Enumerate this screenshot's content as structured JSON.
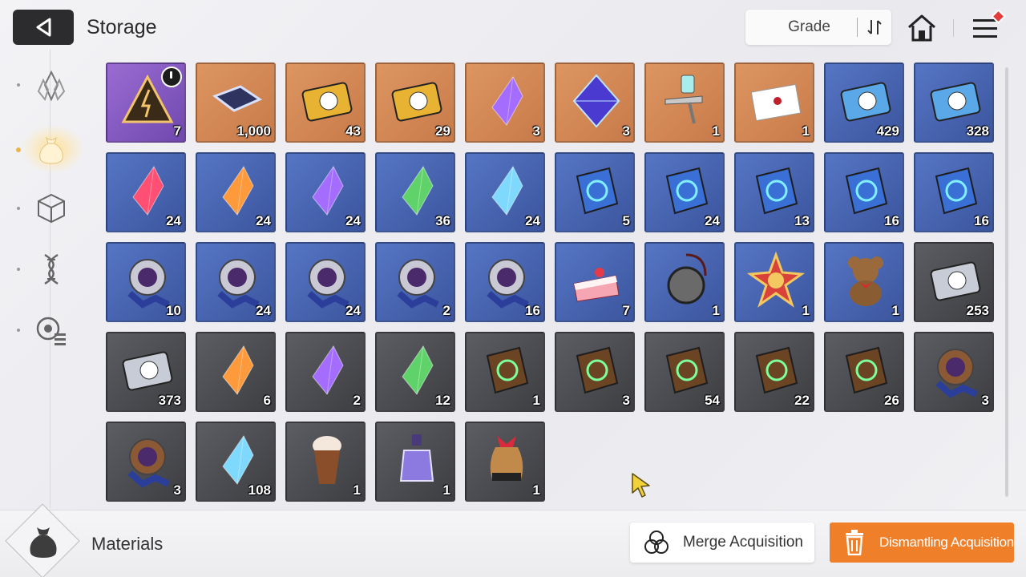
{
  "header": {
    "title": "Storage",
    "sort_label": "Grade"
  },
  "colors": {
    "orange_grade": "#c87a4a",
    "purple_grade": "#6f48ae",
    "blue_grade": "#3c559e",
    "gray_grade": "#3d3e42",
    "action_orange": "#f07f2a"
  },
  "sidebar": {
    "items": [
      {
        "icon": "crystal-icon",
        "active": false
      },
      {
        "icon": "bag-icon",
        "active": true
      },
      {
        "icon": "cube-icon",
        "active": false
      },
      {
        "icon": "dna-icon",
        "active": false
      },
      {
        "icon": "module-list-icon",
        "active": false
      }
    ]
  },
  "items": [
    {
      "name": "timed-pyramid-box",
      "grade": "purple",
      "count": "7",
      "timed": true
    },
    {
      "name": "memory-chip",
      "grade": "orange",
      "count": "1,000"
    },
    {
      "name": "gold-character-ticket",
      "grade": "orange",
      "count": "43"
    },
    {
      "name": "gold-star-ticket",
      "grade": "orange",
      "count": "29"
    },
    {
      "name": "purple-eye-core",
      "grade": "orange",
      "count": "3"
    },
    {
      "name": "violet-octahedron",
      "grade": "orange",
      "count": "3"
    },
    {
      "name": "spray-gun",
      "grade": "orange",
      "count": "1"
    },
    {
      "name": "sealed-letter",
      "grade": "orange",
      "count": "1"
    },
    {
      "name": "blue-character-ticket",
      "grade": "blue",
      "count": "429"
    },
    {
      "name": "blue-star-ticket",
      "grade": "blue",
      "count": "328"
    },
    {
      "name": "red-crystal",
      "grade": "blue",
      "count": "24"
    },
    {
      "name": "orange-crystal",
      "grade": "blue",
      "count": "24"
    },
    {
      "name": "purple-crystal",
      "grade": "blue",
      "count": "24"
    },
    {
      "name": "green-crystal",
      "grade": "blue",
      "count": "36"
    },
    {
      "name": "ice-crystal",
      "grade": "blue",
      "count": "24"
    },
    {
      "name": "shield-manual",
      "grade": "blue",
      "count": "5"
    },
    {
      "name": "target-manual",
      "grade": "blue",
      "count": "24"
    },
    {
      "name": "wing-manual",
      "grade": "blue",
      "count": "13"
    },
    {
      "name": "bolt-manual",
      "grade": "blue",
      "count": "16"
    },
    {
      "name": "orb-manual",
      "grade": "blue",
      "count": "16"
    },
    {
      "name": "cross-emblem",
      "grade": "blue",
      "count": "10"
    },
    {
      "name": "shield-emblem",
      "grade": "blue",
      "count": "24"
    },
    {
      "name": "square-emblem",
      "grade": "blue",
      "count": "24"
    },
    {
      "name": "star-emblem",
      "grade": "blue",
      "count": "2"
    },
    {
      "name": "orb-emblem",
      "grade": "blue",
      "count": "16"
    },
    {
      "name": "strawberry-cake",
      "grade": "blue",
      "count": "7"
    },
    {
      "name": "pocket-watch",
      "grade": "blue",
      "count": "1"
    },
    {
      "name": "star-medal",
      "grade": "blue",
      "count": "1"
    },
    {
      "name": "teddy-bear",
      "grade": "blue",
      "count": "1"
    },
    {
      "name": "silver-character-ticket",
      "grade": "gray",
      "count": "253"
    },
    {
      "name": "silver-star-ticket",
      "grade": "gray",
      "count": "373"
    },
    {
      "name": "dull-orange-shard",
      "grade": "gray",
      "count": "6"
    },
    {
      "name": "dull-purple-shard",
      "grade": "gray",
      "count": "2"
    },
    {
      "name": "dull-green-shard",
      "grade": "gray",
      "count": "12"
    },
    {
      "name": "brown-sword-manual",
      "grade": "gray",
      "count": "1"
    },
    {
      "name": "brown-target-manual",
      "grade": "gray",
      "count": "3"
    },
    {
      "name": "brown-wing-manual",
      "grade": "gray",
      "count": "54"
    },
    {
      "name": "brown-bolt-manual",
      "grade": "gray",
      "count": "22"
    },
    {
      "name": "brown-orb-manual",
      "grade": "gray",
      "count": "26"
    },
    {
      "name": "bronze-shield-emblem",
      "grade": "gray",
      "count": "3"
    },
    {
      "name": "bronze-square-emblem",
      "grade": "gray",
      "count": "3"
    },
    {
      "name": "blue-ore-chunk",
      "grade": "gray",
      "count": "108"
    },
    {
      "name": "iced-coffee",
      "grade": "gray",
      "count": "1"
    },
    {
      "name": "perfume-bottle",
      "grade": "gray",
      "count": "1"
    },
    {
      "name": "gift-pouch",
      "grade": "gray",
      "count": "1"
    }
  ],
  "footer": {
    "category_label": "Materials",
    "merge_label": "Merge Acquisition",
    "dismantle_label": "Dismantling Acquisition"
  }
}
